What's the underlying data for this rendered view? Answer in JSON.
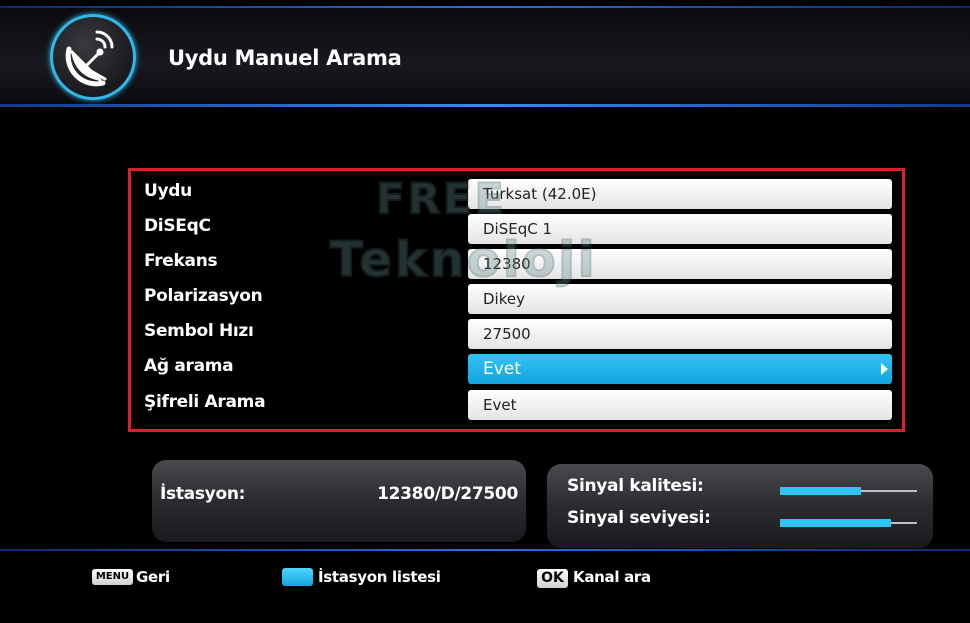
{
  "header": {
    "title": "Uydu Manuel Arama",
    "icon": "satellite-dish-icon"
  },
  "settings": {
    "rows": [
      {
        "label": "Uydu",
        "value": "Turksat (42.0E)"
      },
      {
        "label": "DiSEqC",
        "value": "DiSEqC 1"
      },
      {
        "label": "Frekans",
        "value": "12380"
      },
      {
        "label": "Polarizasyon",
        "value": "Dikey"
      },
      {
        "label": "Sembol Hızı",
        "value": "27500"
      },
      {
        "label": "Ağ arama",
        "value": "Evet"
      },
      {
        "label": "Şifreli Arama",
        "value": "Evet"
      }
    ],
    "selected_index": 5
  },
  "watermark": {
    "line1": "FREE",
    "line2": "Teknoloji"
  },
  "station": {
    "label": "İstasyon:",
    "value": "12380/D/27500"
  },
  "signal": {
    "quality_label": "Sinyal kalitesi:",
    "level_label": "Sinyal seviyesi:",
    "quality_level": 0.59,
    "level_level": 0.81
  },
  "footer": {
    "menu_key": "MENU",
    "menu_label": "Geri",
    "blue_label": "İstasyon listesi",
    "ok_key": "OK",
    "ok_label": "Kanal ara"
  },
  "colors": {
    "accent": "#2fc4f4",
    "border": "#d9212b",
    "header_line": "#2d6fe0"
  }
}
